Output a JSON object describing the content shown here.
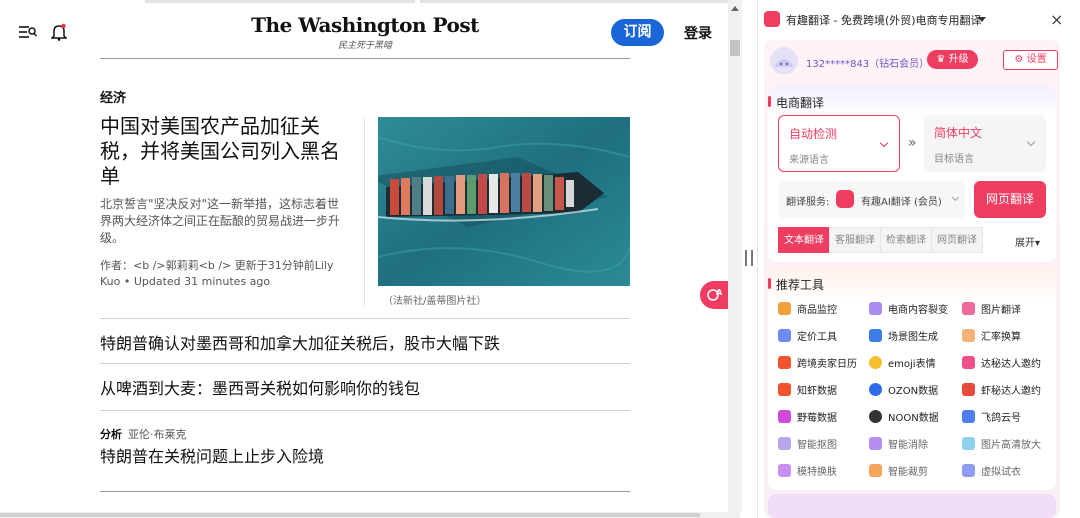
{
  "news": {
    "logo": "The Washington Post",
    "tagline": "民主死于黑暗",
    "subscribe_label": "订阅",
    "login_label": "登录",
    "section": "经济",
    "lead": {
      "headline": "中国对美国农产品加征关税，并将美国公司列入黑名单",
      "summary": "北京誓言\"坚决反对\"这一新举措，这标志着世界两大经济体之间正在酝酿的贸易战进一步升级。",
      "byline": "作者：<b />郭莉莉<b /> 更新于31分钟前Lily Kuo • Updated 31 minutes ago",
      "image_caption": "（法新社/盖蒂图片社）"
    },
    "headline_2": "特朗普确认对墨西哥和加拿大加征关税后，股市大幅下跌",
    "headline_3": "从啤酒到大麦：墨西哥关税如何影响你的钱包",
    "analysis_label": "分析",
    "analysis_author": "亚伦·布莱克",
    "headline_4": "特朗普在关税问题上止步入险境"
  },
  "extension": {
    "title": "有趣翻译 - 免费跨境(外贸)电商专用翻译",
    "close": "×",
    "user": "132*****843（钻石会员）",
    "upgrade_label": "升级",
    "settings_label": "设置",
    "ecommerce_title": "电商翻译",
    "source_lang": "自动检测",
    "source_sub": "来源语言",
    "target_lang": "简体中文",
    "target_sub": "目标语言",
    "swap_symbol": "»",
    "service_label": "翻译服务:",
    "service_name": "有趣AI翻译 (会员)",
    "page_translate_label": "网页翻译",
    "tabs": [
      "文本翻译",
      "客服翻译",
      "检索翻译",
      "网页翻译"
    ],
    "expand_label": "展开▾",
    "tools_title": "推荐工具",
    "tools": [
      {
        "label": "商品监控",
        "color": "#f2a13a"
      },
      {
        "label": "电商内容裂变",
        "color": "#a98cf0"
      },
      {
        "label": "图片翻译",
        "color": "#f06aa0"
      },
      {
        "label": "定价工具",
        "color": "#6c8cf2"
      },
      {
        "label": "场景图生成",
        "color": "#3b7ee8"
      },
      {
        "label": "汇率换算",
        "color": "#f7b27a"
      },
      {
        "label": "跨境卖家日历",
        "color": "#f0542c"
      },
      {
        "label": "emoji表情",
        "color": "#f3c12c"
      },
      {
        "label": "达秘达人邀约",
        "color": "#f0508a"
      },
      {
        "label": "知虾数据",
        "color": "#f0542c"
      },
      {
        "label": "OZON数据",
        "color": "#2f6be8"
      },
      {
        "label": "虾秘达人邀约",
        "color": "#e84a3c"
      },
      {
        "label": "野莓数据",
        "color": "#d04ad8"
      },
      {
        "label": "NOON数据",
        "color": "#333333"
      },
      {
        "label": "飞鸽云号",
        "color": "#4f7ef0"
      },
      {
        "label": "智能抠图",
        "color": "#b9a4ee"
      },
      {
        "label": "智能消除",
        "color": "#b58ef2"
      },
      {
        "label": "图片高清放大",
        "color": "#8fd0ef"
      },
      {
        "label": "模特换肤",
        "color": "#c88ff2"
      },
      {
        "label": "智能裁剪",
        "color": "#f3a65a"
      },
      {
        "label": "虚拟试衣",
        "color": "#8f9cf2"
      }
    ]
  }
}
